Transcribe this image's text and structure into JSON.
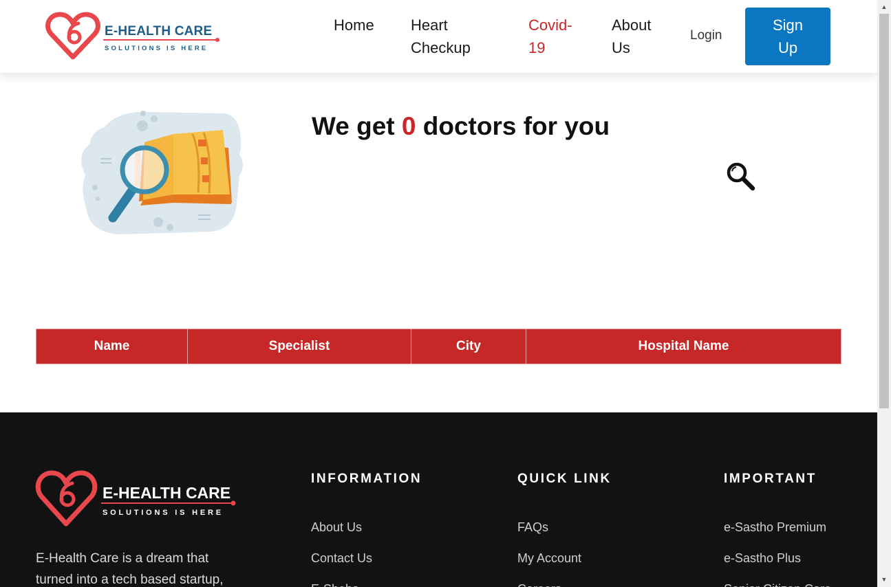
{
  "brand": {
    "name": "E-HEALTH CARE",
    "tagline": "SOLUTIONS IS HERE",
    "colors": {
      "heart": "#e8484c",
      "text": "#1c5d8a",
      "accent": "#c62828",
      "primary": "#0b77c2"
    }
  },
  "nav": {
    "home": "Home",
    "heart_checkup": "Heart Checkup",
    "covid": "Covid-19",
    "about": "About Us",
    "login": "Login",
    "signup": "Sign Up"
  },
  "results": {
    "prefix": "We get",
    "count": "0",
    "suffix": "doctors for you",
    "search_icon": "search-icon"
  },
  "table": {
    "columns": [
      "Name",
      "Specialist",
      "City",
      "Hospital Name"
    ],
    "rows": []
  },
  "footer": {
    "brand_name": "E-HEALTH CARE",
    "brand_tagline": "SOLUTIONS IS HERE",
    "about_text": "E-Health Care is a dream that turned into a tech based startup,",
    "columns": [
      {
        "heading": "INFORMATION",
        "links": [
          "About Us",
          "Contact Us",
          "E-Sheba"
        ]
      },
      {
        "heading": "QUICK LINK",
        "links": [
          "FAQs",
          "My Account",
          "Careers"
        ]
      },
      {
        "heading": "IMPORTANT",
        "links": [
          "e-Sastho Premium",
          "e-Sastho Plus",
          "Senior Citizen Care"
        ]
      }
    ]
  }
}
